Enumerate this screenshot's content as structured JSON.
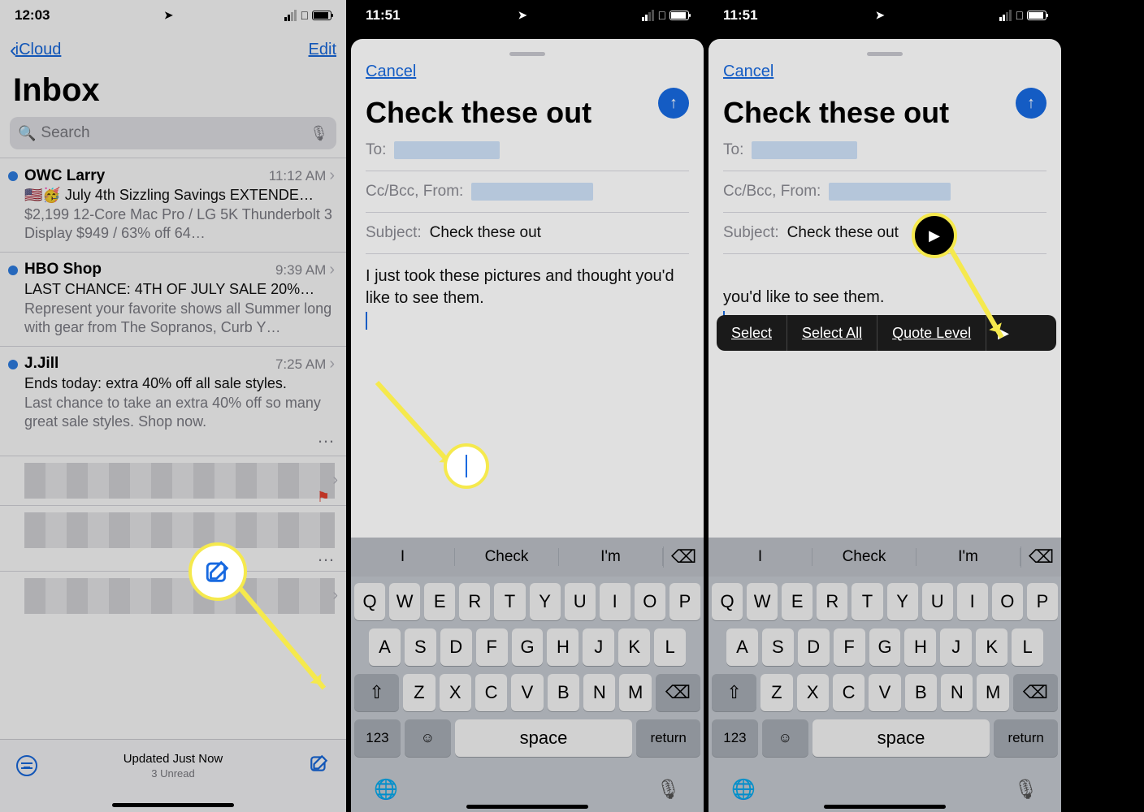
{
  "s1": {
    "time": "12:03",
    "back": "iCloud",
    "edit": "Edit",
    "title": "Inbox",
    "search_ph": "Search",
    "rows": [
      {
        "sender": "OWC Larry",
        "time": "11:12 AM",
        "subj": "🇺🇸🥳 July 4th Sizzling Savings EXTENDE…",
        "prev": "$2,199 12-Core Mac Pro / LG 5K Thunderbolt 3 Display $949 / 63% off 64…"
      },
      {
        "sender": "HBO Shop",
        "time": "9:39 AM",
        "subj": "LAST CHANCE: 4TH OF JULY SALE 20%…",
        "prev": "Represent your favorite shows all Summer long with gear from The Sopranos, Curb Y…"
      },
      {
        "sender": "J.Jill",
        "time": "7:25 AM",
        "subj": "Ends today: extra 40% off all sale styles.",
        "prev": "Last chance to take an extra 40% off so many great sale styles. Shop now."
      }
    ],
    "updated": "Updated Just Now",
    "unread": "3 Unread"
  },
  "compose": {
    "cancel": "Cancel",
    "title": "Check these out",
    "to": "To:",
    "cc": "Cc/Bcc, From:",
    "subject_lbl": "Subject:",
    "subject": "Check these out",
    "body": "I just took these pictures and thought you'd like to see them.",
    "body_tail": "you'd like to see them."
  },
  "kb": {
    "s1": "I",
    "s2": "Check",
    "s3": "I'm",
    "r1": [
      "Q",
      "W",
      "E",
      "R",
      "T",
      "Y",
      "U",
      "I",
      "O",
      "P"
    ],
    "r2": [
      "A",
      "S",
      "D",
      "F",
      "G",
      "H",
      "J",
      "K",
      "L"
    ],
    "r3": [
      "Z",
      "X",
      "C",
      "V",
      "B",
      "N",
      "M"
    ],
    "num": "123",
    "space": "space",
    "ret": "return"
  },
  "ctx": {
    "a": "Select",
    "b": "Select All",
    "c": "Quote Level"
  },
  "time2": "11:51"
}
